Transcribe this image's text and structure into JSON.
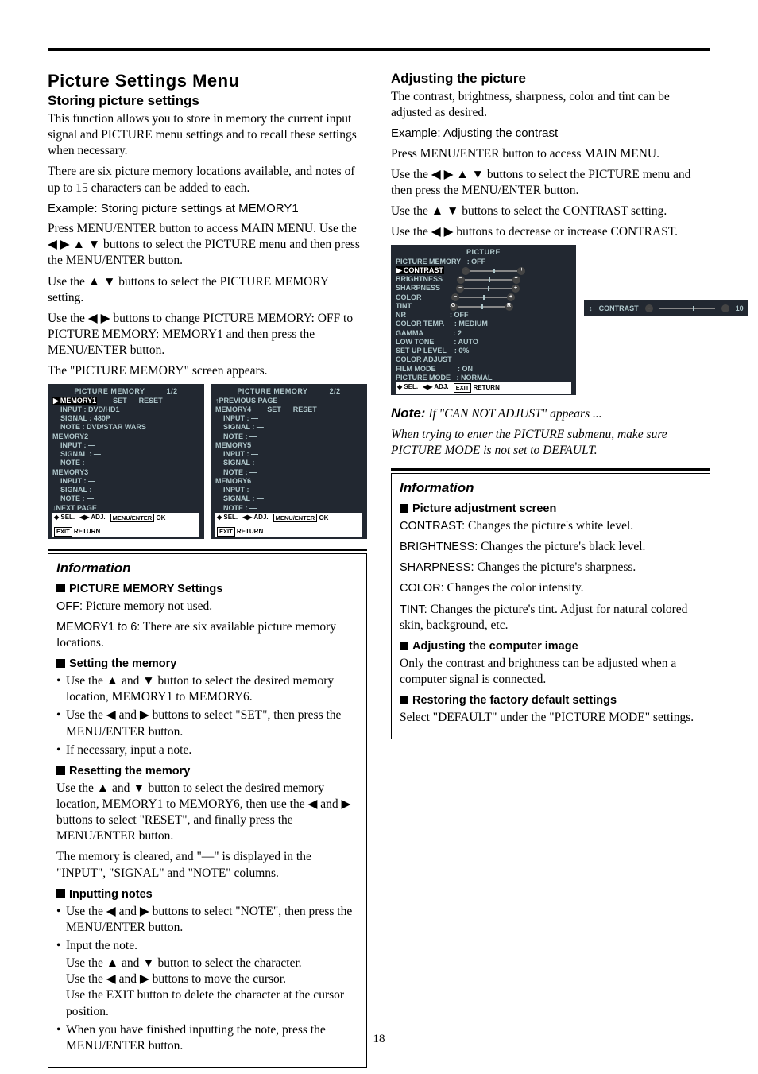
{
  "pageNumber": "18",
  "left": {
    "title": "Picture Settings Menu",
    "h1": "Storing picture settings",
    "p1": "This function allows you to store in memory the current input signal and PICTURE menu settings and to recall these settings when necessary.",
    "p2": "There are six picture memory locations available, and notes of up to 15 characters can be added to each.",
    "example": "Example: Storing picture settings at MEMORY1",
    "p3": "Press MENU/ENTER button to access MAIN MENU. Use the ◀ ▶ ▲ ▼ buttons to select the PICTURE menu and then press the MENU/ENTER button.",
    "p4": "Use the ▲ ▼ buttons to select the PICTURE MEMORY setting.",
    "p5": "Use the ◀ ▶ buttons to change PICTURE MEMORY: OFF to PICTURE MEMORY: MEMORY1 and then press the MENU/ENTER button.",
    "p6": "The \"PICTURE MEMORY\" screen appears.",
    "osd1": {
      "title": "PICTURE MEMORY",
      "page": "1/2",
      "r1": "MEMORY1",
      "r1b": "SET",
      "r1c": "RESET",
      "r2": "INPUT : DVD/HD1",
      "r3": "SIGNAL : 480P",
      "r4": "NOTE : DVD/STAR WARS",
      "r5": "MEMORY2",
      "r6": "INPUT : —",
      "r7": "SIGNAL : —",
      "r8": "NOTE : —",
      "r9": "MEMORY3",
      "r10": "INPUT : —",
      "r11": "SIGNAL : —",
      "r12": "NOTE : —",
      "next": "↓NEXT PAGE",
      "f1": "SEL.",
      "f2": "ADJ.",
      "f3": "OK",
      "f4": "RETURN"
    },
    "osd2": {
      "title": "PICTURE MEMORY",
      "page": "2/2",
      "prev": "↑PREVIOUS PAGE",
      "r1": "MEMORY4",
      "r1b": "SET",
      "r1c": "RESET",
      "r2": "INPUT : —",
      "r3": "SIGNAL : —",
      "r4": "NOTE : —",
      "r5": "MEMORY5",
      "r6": "INPUT : —",
      "r7": "SIGNAL : —",
      "r8": "NOTE : —",
      "r9": "MEMORY6",
      "r10": "INPUT : —",
      "r11": "SIGNAL : —",
      "r12": "NOTE : —",
      "f1": "SEL.",
      "f2": "ADJ.",
      "f3": "OK",
      "f4": "RETURN"
    },
    "info": {
      "head": "Information",
      "s1": "PICTURE MEMORY Settings",
      "s1a": "OFF:",
      "s1at": " Picture memory not used.",
      "s1b": "MEMORY1 to 6:",
      "s1bt": " There are six available picture memory locations.",
      "s2": "Setting the memory",
      "s2i1": "Use the ▲ and ▼ button to select the desired memory location, MEMORY1 to MEMORY6.",
      "s2i2": "Use the ◀ and ▶ buttons to select \"SET\", then press the MENU/ENTER button.",
      "s2i3": "If necessary, input a note.",
      "s3": "Resetting the memory",
      "s3p1": "Use the ▲ and ▼ button to select the desired memory location, MEMORY1 to MEMORY6, then use the ◀ and ▶ buttons to select \"RESET\", and finally press the MENU/ENTER button.",
      "s3p2": "The memory is cleared, and \"—\" is displayed in the \"INPUT\", \"SIGNAL\" and \"NOTE\" columns.",
      "s4": "Inputting notes",
      "s4i1": "Use the ◀ and ▶ buttons to select \"NOTE\", then press the MENU/ENTER button.",
      "s4i2": "Input the note.",
      "s4i2a": "Use the ▲ and ▼ button to select the character.",
      "s4i2b": "Use the ◀ and ▶ buttons to move the cursor.",
      "s4i2c": "Use the EXIT button to delete the character at the cursor position.",
      "s4i3": "When you have finished inputting the note, press the MENU/ENTER button."
    }
  },
  "right": {
    "h1": "Adjusting the picture",
    "p1": "The contrast, brightness, sharpness, color and tint can be adjusted as desired.",
    "example": "Example: Adjusting the contrast",
    "p2": "Press MENU/ENTER button to access MAIN MENU.",
    "p3": "Use the ◀ ▶ ▲ ▼ buttons to select the PICTURE menu and then press the MENU/ENTER button.",
    "p4": "Use the ▲ ▼ buttons to select the CONTRAST setting.",
    "p5": "Use the ◀ ▶ buttons to decrease or increase CONTRAST.",
    "osd": {
      "title": "PICTURE",
      "r1": "PICTURE MEMORY",
      "r1v": ": OFF",
      "r2": "CONTRAST",
      "r3": "BRIGHTNESS",
      "r4": "SHARPNESS",
      "r5": "COLOR",
      "r6": "TINT",
      "r7": "NR",
      "r7v": ": OFF",
      "r8": "COLOR TEMP.",
      "r8v": ": MEDIUM",
      "r9": "GAMMA",
      "r9v": ": 2",
      "r10": "LOW TONE",
      "r10v": ": AUTO",
      "r11": "SET UP LEVEL",
      "r11v": ": 0%",
      "r12": "COLOR ADJUST",
      "r13": "FILM MODE",
      "r13v": ": ON",
      "r14": "PICTURE MODE",
      "r14v": ": NORMAL",
      "f1": "SEL.",
      "f2": "ADJ.",
      "f3": "RETURN"
    },
    "osdmini": {
      "label": "CONTRAST",
      "val": "10"
    },
    "noteLabel": "Note:",
    "noteItalic": " If \"CAN NOT ADJUST\" appears ...",
    "noteBody": "When trying to enter the PICTURE submenu, make sure PICTURE MODE is not set to DEFAULT.",
    "info": {
      "head": "Information",
      "s1": "Picture adjustment screen",
      "l1a": "CONTRAST:",
      "l1b": " Changes the picture's white level.",
      "l2a": "BRIGHTNESS:",
      "l2b": " Changes the picture's black level.",
      "l3a": "SHARPNESS:",
      "l3b": " Changes the picture's sharpness.",
      "l4a": "COLOR:",
      "l4b": " Changes the color intensity.",
      "l5a": "TINT:",
      "l5b": " Changes the picture's tint. Adjust for natural colored skin, background, etc.",
      "s2": "Adjusting the computer image",
      "s2p": "Only the contrast and brightness can be adjusted when a computer signal is connected.",
      "s3": "Restoring the factory default settings",
      "s3p": "Select \"DEFAULT\" under the \"PICTURE MODE\" settings."
    }
  }
}
